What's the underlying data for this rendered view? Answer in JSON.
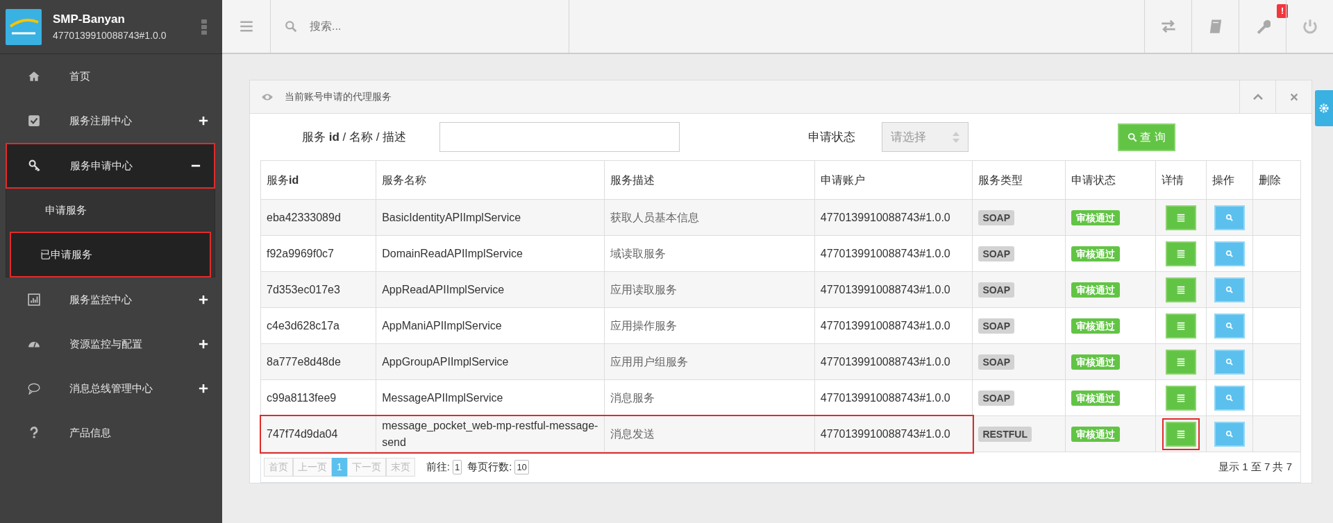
{
  "brand": {
    "title": "SMP-Banyan",
    "account": "4770139910088743#1.0.0"
  },
  "topbar": {
    "search_placeholder": "搜索...",
    "alert_badge": "!"
  },
  "sidebar": {
    "items": [
      {
        "label": "首页",
        "expandable": false,
        "expanded": false,
        "highlighted": false
      },
      {
        "label": "服务注册中心",
        "expandable": true,
        "expanded": false,
        "highlighted": false
      },
      {
        "label": "服务申请中心",
        "expandable": true,
        "expanded": true,
        "highlighted": true,
        "children": [
          {
            "label": "申请服务",
            "selected": false,
            "highlighted": false
          },
          {
            "label": "已申请服务",
            "selected": true,
            "highlighted": true
          }
        ]
      },
      {
        "label": "服务监控中心",
        "expandable": true,
        "expanded": false,
        "highlighted": false
      },
      {
        "label": "资源监控与配置",
        "expandable": true,
        "expanded": false,
        "highlighted": false
      },
      {
        "label": "消息总线管理中心",
        "expandable": true,
        "expanded": false,
        "highlighted": false
      },
      {
        "label": "产品信息",
        "expandable": false,
        "expanded": false,
        "highlighted": false
      }
    ]
  },
  "panel": {
    "title": "当前账号申请的代理服务",
    "filter": {
      "label": "服务 **id** / 名称 / 描述",
      "status_label": "申请状态",
      "status_placeholder": "请选择",
      "query_button": "查 询"
    },
    "table": {
      "columns": [
        "服务**id**",
        "服务名称",
        "服务描述",
        "申请账户",
        "服务类型",
        "申请状态",
        "详情",
        "操作",
        "删除"
      ],
      "rows": [
        {
          "id": "eba42333089d",
          "name": "BasicIdentityAPIImplService",
          "desc": "获取人员基本信息",
          "account": "4770139910088743#1.0.0",
          "type": "SOAP",
          "status": "审核通过",
          "highlighted": false
        },
        {
          "id": "f92a9969f0c7",
          "name": "DomainReadAPIImplService",
          "desc": "域读取服务",
          "account": "4770139910088743#1.0.0",
          "type": "SOAP",
          "status": "审核通过",
          "highlighted": false
        },
        {
          "id": "7d353ec017e3",
          "name": "AppReadAPIImplService",
          "desc": "应用读取服务",
          "account": "4770139910088743#1.0.0",
          "type": "SOAP",
          "status": "审核通过",
          "highlighted": false
        },
        {
          "id": "c4e3d628c17a",
          "name": "AppManiAPIImplService",
          "desc": "应用操作服务",
          "account": "4770139910088743#1.0.0",
          "type": "SOAP",
          "status": "审核通过",
          "highlighted": false
        },
        {
          "id": "8a777e8d48de",
          "name": "AppGroupAPIImplService",
          "desc": "应用用户组服务",
          "account": "4770139910088743#1.0.0",
          "type": "SOAP",
          "status": "审核通过",
          "highlighted": false
        },
        {
          "id": "c99a8113fee9",
          "name": "MessageAPIImplService",
          "desc": "消息服务",
          "account": "4770139910088743#1.0.0",
          "type": "SOAP",
          "status": "审核通过",
          "highlighted": false
        },
        {
          "id": "747f74d9da04",
          "name": "message_pocket_web-mp-restful-message-send",
          "desc": "消息发送",
          "account": "4770139910088743#1.0.0",
          "type": "RESTFUL",
          "status": "审核通过",
          "highlighted": true
        }
      ]
    },
    "pagination": {
      "buttons": [
        {
          "label": "首页",
          "selected": false
        },
        {
          "label": "上一页",
          "selected": false
        },
        {
          "label": "1",
          "selected": true
        },
        {
          "label": "下一页",
          "selected": false
        },
        {
          "label": "末页",
          "selected": false
        }
      ],
      "goto_label": "前往:",
      "goto_value": "1",
      "rows_label": "每页行数:",
      "rows_value": "10",
      "summary": "显示 1 至 7 共 7"
    }
  }
}
